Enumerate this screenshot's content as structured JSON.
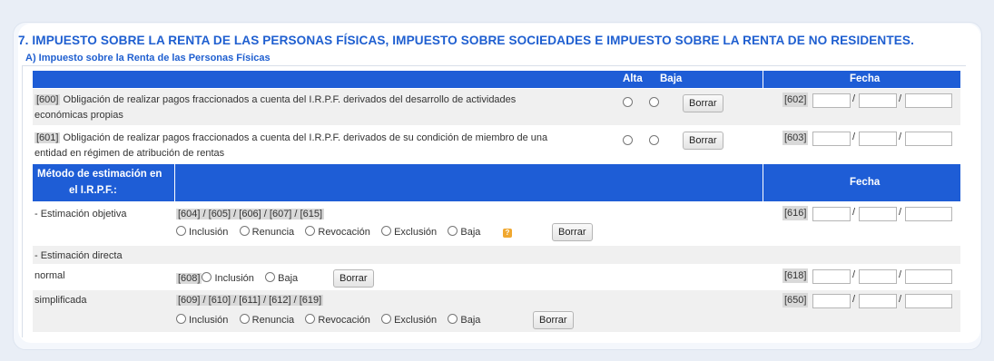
{
  "section_title": "7. IMPUESTO SOBRE LA RENTA DE LAS PERSONAS FÍSICAS, IMPUESTO SOBRE SOCIEDADES E IMPUESTO SOBRE LA RENTA DE NO RESIDENTES.",
  "subsection_title": "A) Impuesto sobre la Renta de las Personas Físicas",
  "header1": {
    "alta": "Alta",
    "baja": "Baja",
    "fecha": "Fecha"
  },
  "rows": [
    {
      "code": "[600]",
      "text_line1": " Obligación de realizar pagos fraccionados a cuenta del I.R.P.F. derivados del desarrollo de actividades",
      "text_line2": "económicas propias",
      "button": "Borrar",
      "date_code": "[602]",
      "sep": "/"
    },
    {
      "code": "[601]",
      "text_line1": " Obligación de realizar pagos fraccionados a cuenta del I.R.P.F. derivados de su condición de miembro de una",
      "text_line2": "entidad en régimen de atribución de rentas",
      "button": "Borrar",
      "date_code": "[603]",
      "sep": "/"
    }
  ],
  "header2": {
    "metodo_line1": "Método de estimación en",
    "metodo_line2": "el I.R.P.F.:",
    "fecha": "Fecha"
  },
  "estimacion_objetiva": {
    "label": "- Estimación objetiva",
    "codes": "[604] / [605] / [606] / [607] / [615]",
    "options": [
      "Inclusión",
      "Renuncia",
      "Revocación",
      "Exclusión",
      "Baja"
    ],
    "help": "?",
    "button": "Borrar",
    "date_code": "[616]"
  },
  "estimacion_directa": {
    "label": "- Estimación directa"
  },
  "normal": {
    "label": "normal",
    "code": "[608]",
    "options": [
      "Inclusión",
      "Baja"
    ],
    "button": "Borrar",
    "date_code": "[618]"
  },
  "simplificada": {
    "label": "simplificada",
    "codes": "[609] / [610] / [611] / [612] / [619]",
    "options": [
      "Inclusión",
      "Renuncia",
      "Revocación",
      "Exclusión",
      "Baja"
    ],
    "button": "Borrar",
    "date_code": "[650]"
  },
  "date_sep": "/",
  "colors": {
    "accent": "#1f5fd0",
    "header_bar": "#1e5dd6",
    "row_grey": "#f0f0f0"
  }
}
